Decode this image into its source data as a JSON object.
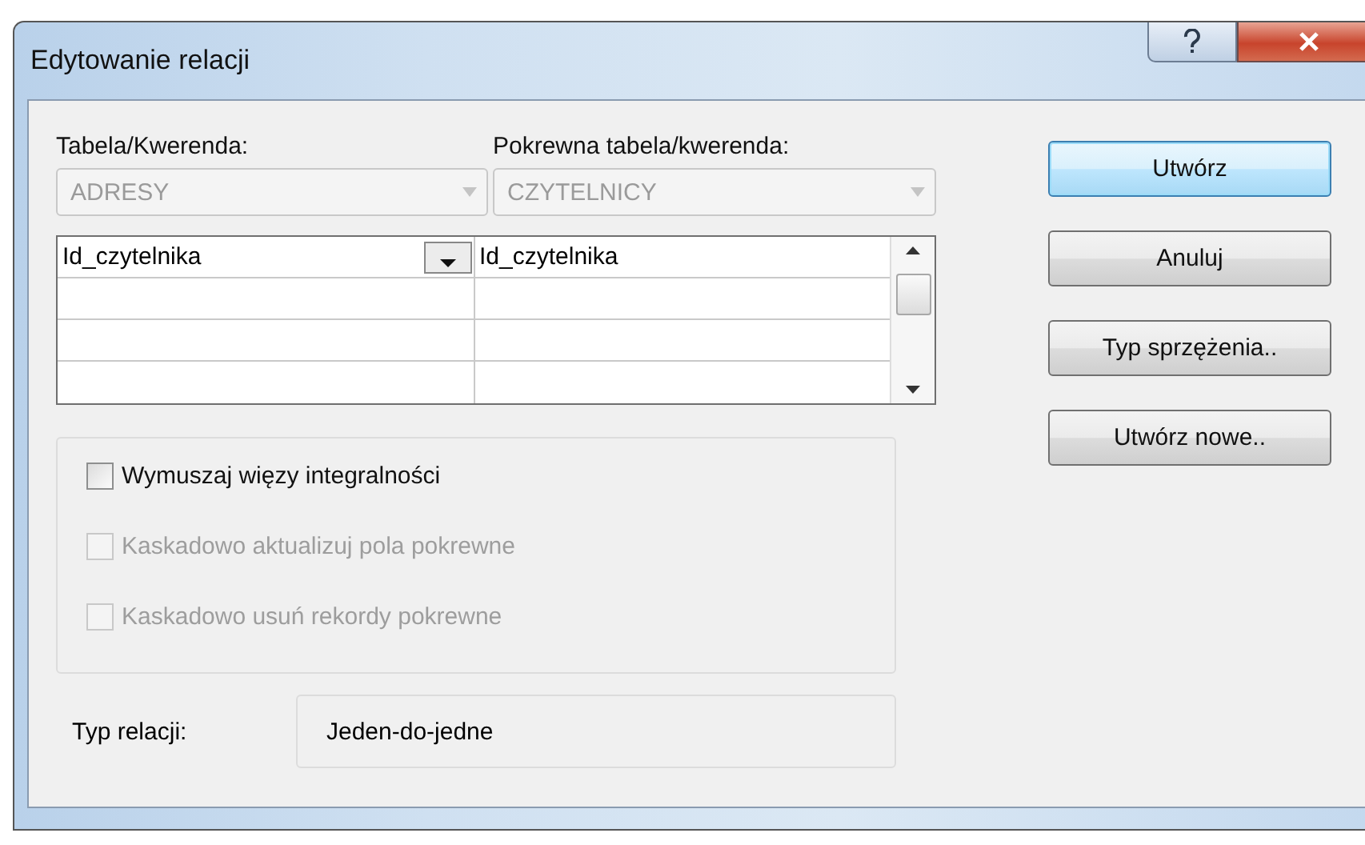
{
  "window": {
    "title": "Edytowanie relacji"
  },
  "table": {
    "label": "Tabela/Kwerenda:",
    "value": "ADRESY",
    "disabled": true
  },
  "related_table": {
    "label": "Pokrewna tabela/kwerenda:",
    "value": "CZYTELNICY",
    "disabled": true
  },
  "fields_grid": {
    "rows": [
      {
        "column_1": "Id_czytelnika",
        "column_2": "Id_czytelnika",
        "dropdown_open": false
      }
    ]
  },
  "options": [
    {
      "label": "Wymuszaj więzy integralności",
      "checked": false,
      "disabled": false
    },
    {
      "label": "Kaskadowo aktualizuj pola pokrewne",
      "checked": false,
      "disabled": true
    },
    {
      "label": "Kaskadowo usuń rekordy pokrewne",
      "checked": false,
      "disabled": true
    }
  ],
  "relation_type": {
    "label": "Typ relacji:",
    "value": "Jeden-do-jedne"
  },
  "buttons": [
    {
      "label": "Utwórz",
      "default": true
    },
    {
      "label": "Anuluj",
      "default": false
    },
    {
      "label": "Typ sprzężenia..",
      "default": false
    },
    {
      "label": "Utwórz nowe..",
      "default": false
    }
  ]
}
